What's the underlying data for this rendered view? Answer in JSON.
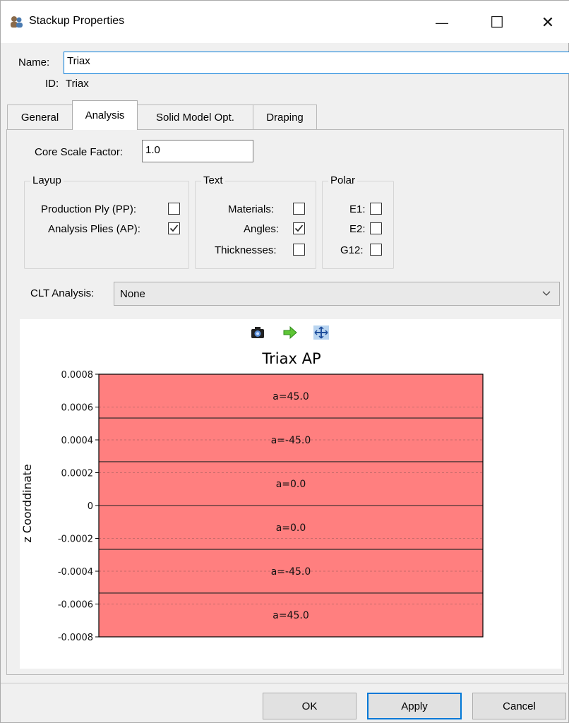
{
  "window": {
    "title": "Stackup Properties",
    "minimize_glyph": "—",
    "maximize_glyph": "☐",
    "close_glyph": "✕"
  },
  "form": {
    "name_label": "Name:",
    "name_value": "Triax",
    "id_label": "ID:",
    "id_value": "Triax"
  },
  "tabs": [
    {
      "label": "General",
      "active": false
    },
    {
      "label": "Analysis",
      "active": true
    },
    {
      "label": "Solid Model Opt.",
      "active": false
    },
    {
      "label": "Draping",
      "active": false
    }
  ],
  "analysis": {
    "core_scale_label": "Core Scale Factor:",
    "core_scale_value": "1.0",
    "layup": {
      "title": "Layup",
      "items": [
        {
          "label": "Production Ply (PP):",
          "checked": false
        },
        {
          "label": "Analysis Plies (AP):",
          "checked": true
        }
      ]
    },
    "text": {
      "title": "Text",
      "items": [
        {
          "label": "Materials:",
          "checked": false
        },
        {
          "label": "Angles:",
          "checked": true
        },
        {
          "label": "Thicknesses:",
          "checked": false
        }
      ]
    },
    "polar": {
      "title": "Polar",
      "items": [
        {
          "label": "E1:",
          "checked": false
        },
        {
          "label": "E2:",
          "checked": false
        },
        {
          "label": "G12:",
          "checked": false
        }
      ]
    },
    "clt_label": "CLT Analysis:",
    "clt_value": "None"
  },
  "toolbar_icons": [
    "camera-icon",
    "export-arrow-icon",
    "fit-view-icon"
  ],
  "chart_data": {
    "type": "bar",
    "title": "Triax AP",
    "xlabel": "",
    "ylabel": "z Coorddinate",
    "ylim": [
      -0.0008,
      0.0008
    ],
    "yticks": [
      0.0008,
      0.0006,
      0.0004,
      0.0002,
      0,
      -0.0002,
      -0.0004,
      -0.0006,
      -0.0008
    ],
    "ytick_labels": [
      "0.0008",
      "0.0006",
      "0.0004",
      "0.0002",
      "0",
      "-0.0002",
      "-0.0004",
      "-0.0006",
      "-0.0008"
    ],
    "plies": [
      {
        "label": "a=45.0",
        "z_top": 0.0008,
        "z_bottom": 0.000533
      },
      {
        "label": "a=-45.0",
        "z_top": 0.000533,
        "z_bottom": 0.000267
      },
      {
        "label": "a=0.0",
        "z_top": 0.000267,
        "z_bottom": 0
      },
      {
        "label": "a=0.0",
        "z_top": 0,
        "z_bottom": -0.000267
      },
      {
        "label": "a=-45.0",
        "z_top": -0.000267,
        "z_bottom": -0.000533
      },
      {
        "label": "a=45.0",
        "z_top": -0.000533,
        "z_bottom": -0.0008
      }
    ],
    "ply_color": "#ff7f7f",
    "grid": true
  },
  "buttons": {
    "ok": "OK",
    "apply": "Apply",
    "cancel": "Cancel"
  }
}
